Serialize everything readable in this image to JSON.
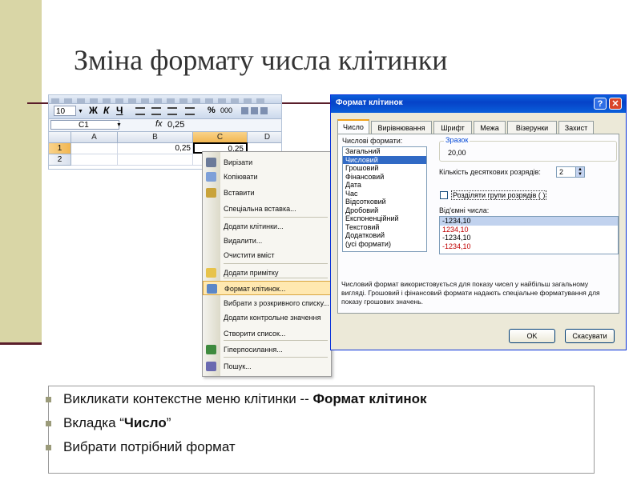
{
  "slide": {
    "title": "Зміна формату числа клітинки",
    "bullets": [
      {
        "text": "Викликати контекстне меню клітинки -- ",
        "bold": "Формат клітинок",
        "suffix": ""
      },
      {
        "text": "Вкладка “",
        "bold": "Число",
        "suffix": "”"
      },
      {
        "text": "Вибрати потрібний формат",
        "bold": "",
        "suffix": ""
      }
    ]
  },
  "excel": {
    "font_size": "10",
    "bold": "Ж",
    "italic": "К",
    "underline": "Ч",
    "percent": "%",
    "thousands": "000",
    "name_box": "C1",
    "fx": "fx",
    "formula_value": "0,25",
    "columns": [
      "A",
      "B",
      "C",
      "D"
    ],
    "rows": [
      "1",
      "2"
    ],
    "cell_b1": "0,25",
    "cell_c1": "0,25"
  },
  "context_menu": {
    "items": [
      {
        "label": "Вирізати",
        "icon": "scissors-icon"
      },
      {
        "label": "Копіювати",
        "icon": "copy-icon"
      },
      {
        "label": "Вставити",
        "icon": "paste-icon"
      },
      {
        "label": "Спеціальна вставка...",
        "icon": ""
      },
      {
        "label": "Додати клітинки...",
        "icon": ""
      },
      {
        "label": "Видалити...",
        "icon": ""
      },
      {
        "label": "Очистити вміст",
        "icon": ""
      },
      {
        "label": "Додати примітку",
        "icon": "comment-icon"
      },
      {
        "label": "Формат клітинок...",
        "icon": "format-cells-icon"
      },
      {
        "label": "Вибрати з розкривного списку...",
        "icon": ""
      },
      {
        "label": "Додати контрольне значення",
        "icon": ""
      },
      {
        "label": "Створити список...",
        "icon": ""
      },
      {
        "label": "Гіперпосилання...",
        "icon": "hyperlink-icon"
      },
      {
        "label": "Пошук...",
        "icon": "search-icon"
      }
    ],
    "highlighted_index": 8
  },
  "dialog": {
    "title": "Формат клітинок",
    "help_label": "?",
    "close_label": "✕",
    "tabs": [
      "Число",
      "Вирівнювання",
      "Шрифт",
      "Межа",
      "Візерунки",
      "Захист"
    ],
    "active_tab": 0,
    "formats_label": "Числові формати:",
    "formats": [
      "Загальний",
      "Числовий",
      "Грошовий",
      "Фінансовий",
      "Дата",
      "Час",
      "Відсотковий",
      "Дробовий",
      "Експоненційний",
      "Текстовий",
      "Додатковий",
      "(усі формати)"
    ],
    "selected_format": 1,
    "sample_label": "Зразок",
    "sample_value": "20,00",
    "decimals_label": "Кількість десяткових розрядів:",
    "decimals_value": "2",
    "group_label": "Розділяти групи розрядів ( )",
    "negative_label": "Від'ємні числа:",
    "negatives": [
      {
        "text": "-1234,10",
        "red": false
      },
      {
        "text": "1234,10",
        "red": true
      },
      {
        "text": "-1234,10",
        "red": false
      },
      {
        "text": "-1234,10",
        "red": true
      }
    ],
    "selected_negative": 0,
    "description": "Числовий формат використовується для показу чисел у найбільш загальному вигляді. Грошовий і фінансовий формати надають спеціальне форматування для показу грошових значень.",
    "ok_label": "OK",
    "cancel_label": "Скасувати"
  }
}
